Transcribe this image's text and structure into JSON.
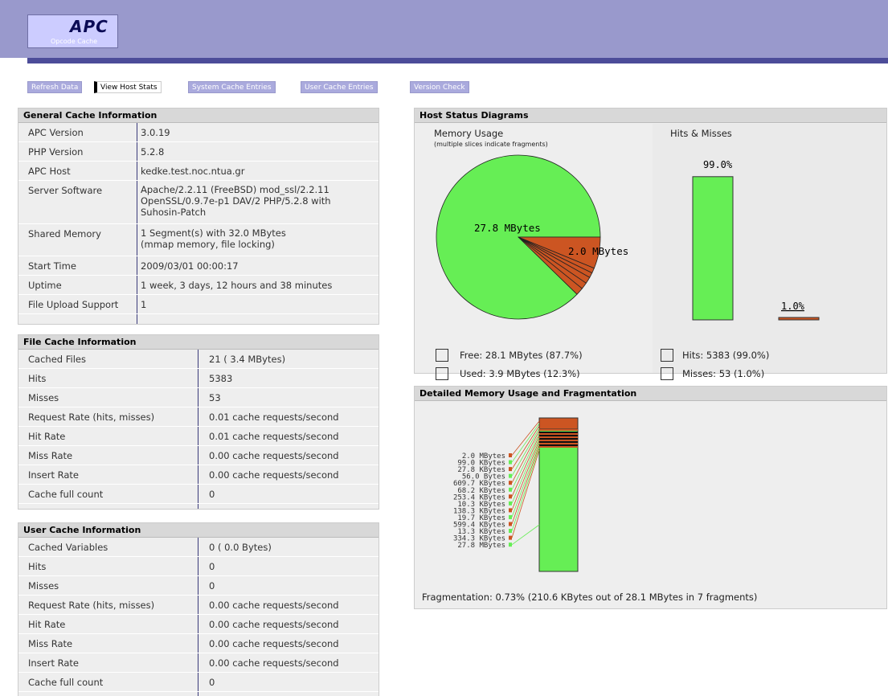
{
  "header": {
    "logo_title": "APC",
    "logo_subtitle": "Opcode Cache"
  },
  "nav": [
    {
      "label": "Refresh Data",
      "active": false
    },
    {
      "label": "View Host Stats",
      "active": true
    },
    {
      "label": "System Cache Entries",
      "active": false
    },
    {
      "label": "User Cache Entries",
      "active": false
    },
    {
      "label": "Version Check",
      "active": false
    }
  ],
  "general": {
    "title": "General Cache Information",
    "rows": [
      {
        "k": "APC Version",
        "v": "3.0.19"
      },
      {
        "k": "PHP Version",
        "v": "5.2.8"
      },
      {
        "k": "APC Host",
        "v": "kedke.test.noc.ntua.gr"
      },
      {
        "k": "Server Software",
        "v1": "Apache/2.2.11 (FreeBSD) mod_ssl/2.2.11",
        "v2": "OpenSSL/0.9.7e-p1 DAV/2 PHP/5.2.8 with",
        "v3": "Suhosin-Patch"
      },
      {
        "k": "Shared Memory",
        "v1": "1 Segment(s) with 32.0 MBytes",
        "v2": "(mmap memory, file locking)"
      },
      {
        "k": "Start Time",
        "v": "2009/03/01 00:00:17"
      },
      {
        "k": "Uptime",
        "v": "1 week, 3 days, 12 hours and 38 minutes"
      },
      {
        "k": "File Upload Support",
        "v": "1"
      }
    ]
  },
  "file_cache": {
    "title": "File Cache Information",
    "rows": [
      {
        "k": "Cached Files",
        "v": "21 ( 3.4 MBytes)"
      },
      {
        "k": "Hits",
        "v": "5383"
      },
      {
        "k": "Misses",
        "v": "53"
      },
      {
        "k": "Request Rate (hits, misses)",
        "v": "0.01 cache requests/second"
      },
      {
        "k": "Hit Rate",
        "v": "0.01 cache requests/second"
      },
      {
        "k": "Miss Rate",
        "v": "0.00 cache requests/second"
      },
      {
        "k": "Insert Rate",
        "v": "0.00 cache requests/second"
      },
      {
        "k": "Cache full count",
        "v": "0"
      }
    ]
  },
  "user_cache": {
    "title": "User Cache Information",
    "rows": [
      {
        "k": "Cached Variables",
        "v": "0 ( 0.0 Bytes)"
      },
      {
        "k": "Hits",
        "v": "0"
      },
      {
        "k": "Misses",
        "v": "0"
      },
      {
        "k": "Request Rate (hits, misses)",
        "v": "0.00 cache requests/second"
      },
      {
        "k": "Hit Rate",
        "v": "0.00 cache requests/second"
      },
      {
        "k": "Miss Rate",
        "v": "0.00 cache requests/second"
      },
      {
        "k": "Insert Rate",
        "v": "0.00 cache requests/second"
      },
      {
        "k": "Cache full count",
        "v": "0"
      }
    ]
  },
  "host_status": {
    "title": "Host Status Diagrams",
    "memory_title": "Memory Usage",
    "memory_note": "(multiple slices indicate fragments)",
    "hits_title": "Hits & Misses",
    "legend_free": "Free: 28.1 MBytes (87.7%)",
    "legend_used": "Used: 3.9 MBytes (12.3%)",
    "legend_hits": "Hits: 5383 (99.0%)",
    "legend_misses": "Misses: 53 (1.0%)"
  },
  "detailed": {
    "title": "Detailed Memory Usage and Fragmentation",
    "fragmentation": "Fragmentation: 0.73% (210.6 KBytes out of 28.1 MBytes in 7 fragments)"
  },
  "colors": {
    "free": "#66ee55",
    "used": "#cc5522",
    "header": "#9999cc",
    "rule": "#4c4c99"
  },
  "chart_data": [
    {
      "type": "pie",
      "title": "Memory Usage",
      "slice_labels": [
        "27.8 MBytes",
        "2.0 MBytes"
      ],
      "legend": [
        "Free: 28.1 MBytes (87.7%)",
        "Used: 3.9 MBytes (12.3%)"
      ],
      "slices": [
        {
          "status": "free",
          "value": 87.7
        },
        {
          "status": "used",
          "value": 6.2
        },
        {
          "status": "used",
          "value": 1.0
        },
        {
          "status": "used",
          "value": 1.0
        },
        {
          "status": "used",
          "value": 1.3
        },
        {
          "status": "used",
          "value": 1.3
        },
        {
          "status": "used",
          "value": 1.5
        }
      ]
    },
    {
      "type": "bar",
      "title": "Hits & Misses",
      "categories": [
        "Hits",
        "Misses"
      ],
      "values": [
        99.0,
        1.0
      ],
      "value_labels": [
        "99.0%",
        "1.0%"
      ],
      "legend": [
        "Hits: 5383 (99.0%)",
        "Misses: 53 (1.0%)"
      ]
    },
    {
      "type": "bar",
      "title": "Detailed Memory Usage and Fragmentation",
      "segments": [
        {
          "label": "2.0 MBytes",
          "status": "used"
        },
        {
          "label": "99.0 KBytes",
          "status": "free"
        },
        {
          "label": "27.8 KBytes",
          "status": "used"
        },
        {
          "label": "56.0 Bytes",
          "status": "free"
        },
        {
          "label": "609.7 KBytes",
          "status": "used"
        },
        {
          "label": "68.2 KBytes",
          "status": "free"
        },
        {
          "label": "253.4 KBytes",
          "status": "used"
        },
        {
          "label": "10.3 KBytes",
          "status": "free"
        },
        {
          "label": "138.3 KBytes",
          "status": "used"
        },
        {
          "label": "19.7 KBytes",
          "status": "free"
        },
        {
          "label": "599.4 KBytes",
          "status": "used"
        },
        {
          "label": "13.3 KBytes",
          "status": "free"
        },
        {
          "label": "334.3 KBytes",
          "status": "used"
        },
        {
          "label": "27.8 MBytes",
          "status": "free"
        }
      ]
    }
  ]
}
